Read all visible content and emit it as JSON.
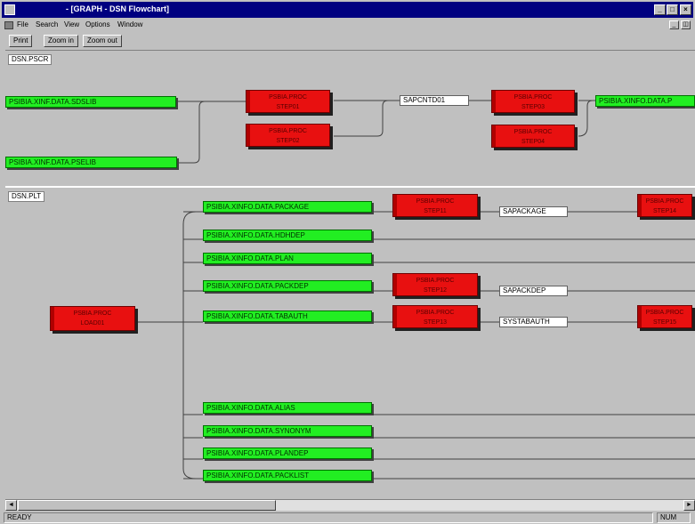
{
  "window": {
    "title": "- [GRAPH - DSN Flowchart]",
    "controls": {
      "minimize": "_",
      "maximize": "□",
      "close": "×"
    }
  },
  "menu": {
    "items": [
      "File",
      "Search",
      "View",
      "Options",
      "Window"
    ],
    "mdi_controls": {
      "minimize": "_",
      "restore": "◫"
    }
  },
  "toolbar": {
    "buttons": [
      "Print",
      "Zoom in",
      "Zoom out"
    ]
  },
  "sections": [
    {
      "tag": "DSN.PSCR",
      "green_nodes": [
        "PSIBIA.XINF.DATA.SDSLIB",
        "PSIBIA.XINF.DATA.PSELIB",
        "PSIBIA.XINFO.DATA.P"
      ],
      "red_nodes": [
        {
          "line1": "PSBIA.PROC",
          "line2": "STEP01"
        },
        {
          "line1": "PSBIA.PROC",
          "line2": "STEP02"
        },
        {
          "line1": "PSBIA.PROC",
          "line2": "STEP03"
        },
        {
          "line1": "PSBIA.PROC",
          "line2": "STEP04"
        }
      ],
      "white_nodes": [
        "SAPCNTD01"
      ]
    },
    {
      "tag": "DSN.PLT",
      "root": {
        "line1": "PSBIA.PROC",
        "line2": "LOAD01"
      },
      "green_nodes": [
        "PSIBIA.XINFO.DATA.PACKAGE",
        "PSIBIA.XINFO.DATA.HDHDEP",
        "PSIBIA.XINFO.DATA.PLAN",
        "PSIBIA.XINFO.DATA.PACKDEP",
        "PSIBIA.XINFO.DATA.TABAUTH",
        "PSIBIA.XINFO.DATA.ALIAS",
        "PSIBIA.XINFO.DATA.SYNONYM",
        "PSIBIA.XINFO.DATA.PLANDEP",
        "PSIBIA.XINFO.DATA.PACKLIST"
      ],
      "red_nodes": [
        {
          "line1": "PSBIA.PROC",
          "line2": "STEP11"
        },
        {
          "line1": "PSBIA.PROC",
          "line2": "STEP12"
        },
        {
          "line1": "PSBIA.PROC",
          "line2": "STEP13"
        },
        {
          "line1": "PSBIA.PROC",
          "line2": "STEP14"
        },
        {
          "line1": "PSBIA.PROC",
          "line2": "STEP15"
        }
      ],
      "white_nodes": [
        "SAPACKAGE",
        "SAPACKDEP",
        "SYSTABAUTH"
      ]
    }
  ],
  "scrollbar": {
    "left_arrow": "◄",
    "right_arrow": "►"
  },
  "status": {
    "left": "READY",
    "right": "NUM"
  }
}
